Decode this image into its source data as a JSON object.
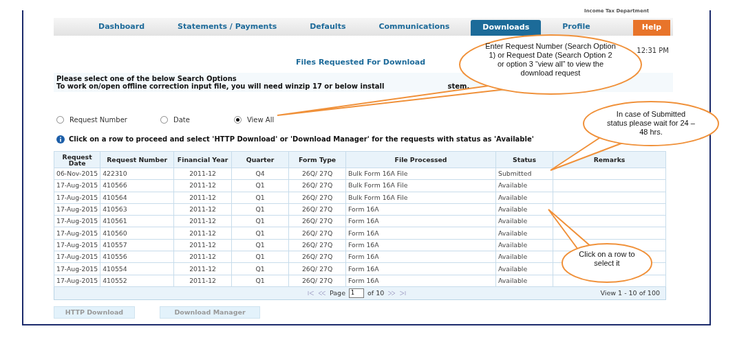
{
  "header_text": "Income Tax Department",
  "nav": [
    {
      "label": "Dashboard",
      "selected": false
    },
    {
      "label": "Statements / Payments",
      "selected": false
    },
    {
      "label": "Defaults",
      "selected": false
    },
    {
      "label": "Communications",
      "selected": false
    },
    {
      "label": "Downloads",
      "selected": true
    },
    {
      "label": "Profile",
      "selected": false
    }
  ],
  "help_button": "Help",
  "page_title": "Files Requested For Download",
  "time": "12:31 PM",
  "instructions": {
    "line_1": "Please select one of the below Search Options",
    "line_2": "To work on/open offline correction input file, you will need winzip 17 or below install",
    "line_2_end": "stem."
  },
  "search_options": [
    {
      "label": "Request Number",
      "selected": false
    },
    {
      "label": "Date",
      "selected": false
    },
    {
      "label": "View All",
      "selected": true
    }
  ],
  "info": "Click on a row to proceed and select 'HTTP Download' or 'Download Manager' for the requests with status as 'Available'",
  "table": {
    "columns": [
      "Request Date",
      "Request Number",
      "Financial Year",
      "Quarter",
      "Form Type",
      "File Processed",
      "Status",
      "Remarks"
    ],
    "rows": [
      [
        "06-Nov-2015",
        "422310",
        "2011-12",
        "Q4",
        "26Q/ 27Q",
        "Bulk Form 16A File",
        "Submitted"
      ],
      [
        "17-Aug-2015",
        "410566",
        "2011-12",
        "Q1",
        "26Q/ 27Q",
        "Bulk Form 16A File",
        "Available"
      ],
      [
        "17-Aug-2015",
        "410564",
        "2011-12",
        "Q1",
        "26Q/ 27Q",
        "Bulk Form 16A File",
        "Available"
      ],
      [
        "17-Aug-2015",
        "410563",
        "2011-12",
        "Q1",
        "26Q/ 27Q",
        "Form 16A",
        "Available"
      ],
      [
        "17-Aug-2015",
        "410561",
        "2011-12",
        "Q1",
        "26Q/ 27Q",
        "Form 16A",
        "Available"
      ],
      [
        "17-Aug-2015",
        "410560",
        "2011-12",
        "Q1",
        "26Q/ 27Q",
        "Form 16A",
        "Available"
      ],
      [
        "17-Aug-2015",
        "410557",
        "2011-12",
        "Q1",
        "26Q/ 27Q",
        "Form 16A",
        "Available"
      ],
      [
        "17-Aug-2015",
        "410556",
        "2011-12",
        "Q1",
        "26Q/ 27Q",
        "Form 16A",
        "Available"
      ],
      [
        "17-Aug-2015",
        "410554",
        "2011-12",
        "Q1",
        "26Q/ 27Q",
        "Form 16A",
        "Available"
      ],
      [
        "17-Aug-2015",
        "410552",
        "2011-12",
        "Q1",
        "26Q/ 27Q",
        "Form 16A",
        "Available"
      ]
    ]
  },
  "pager": {
    "page_label": "Page",
    "page": "1",
    "total": "of 10",
    "summary": "View 1 - 10 of 100"
  },
  "buttons": [
    {
      "label": "HTTP Download",
      "disabled": true
    },
    {
      "label": "Download Manager",
      "disabled": true
    }
  ],
  "callouts": [
    {
      "text": "Enter Request Number (Search Option 1) or Request Date (Search Option 2 or option 3 “view all” to view the download request"
    },
    {
      "text": "In case of Submitted status please wait for 24 – 48 hrs."
    },
    {
      "text": "Click on a row to select it"
    }
  ]
}
